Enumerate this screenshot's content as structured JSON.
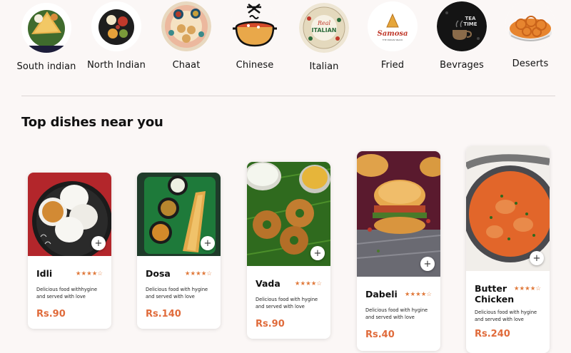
{
  "categories": [
    {
      "label": "South indian",
      "icon": "dosa-plate-icon"
    },
    {
      "label": "North Indian",
      "icon": "thali-plate-icon"
    },
    {
      "label": "Chaat",
      "icon": "chaat-plate-icon"
    },
    {
      "label": "Chinese",
      "icon": "wok-bowl-icon"
    },
    {
      "label": "Italian",
      "icon": "italian-pizza-icon"
    },
    {
      "label": "Fried",
      "icon": "samosa-logo-icon"
    },
    {
      "label": "Bevrages",
      "icon": "tea-time-icon"
    },
    {
      "label": "Deserts",
      "icon": "jalebi-bowl-icon"
    }
  ],
  "section_title": "Top dishes near you",
  "dishes": [
    {
      "name": "Idli",
      "rating": "★★★★☆",
      "description": "Delicious food withhygine and served with love",
      "price": "Rs.90"
    },
    {
      "name": "Dosa",
      "rating": "★★★★☆",
      "description": "Delicious food with hygine and served with love",
      "price": "Rs.140"
    },
    {
      "name": "Vada",
      "rating": "★★★★☆",
      "description": "Delicious food with hygine and served with love",
      "price": "Rs.90"
    },
    {
      "name": "Dabeli",
      "rating": "★★★★☆",
      "description": "Delicious food with hygine and served with love",
      "price": "Rs.40"
    },
    {
      "name": "Butter Chicken",
      "rating": "★★★★☆",
      "description": "Delicious food with hygine and served with love",
      "price": "Rs.240"
    }
  ],
  "add_symbol": "+",
  "colors": {
    "accent": "#e06b3b",
    "stars": "#e07a3c",
    "background": "#fbf7f6"
  }
}
